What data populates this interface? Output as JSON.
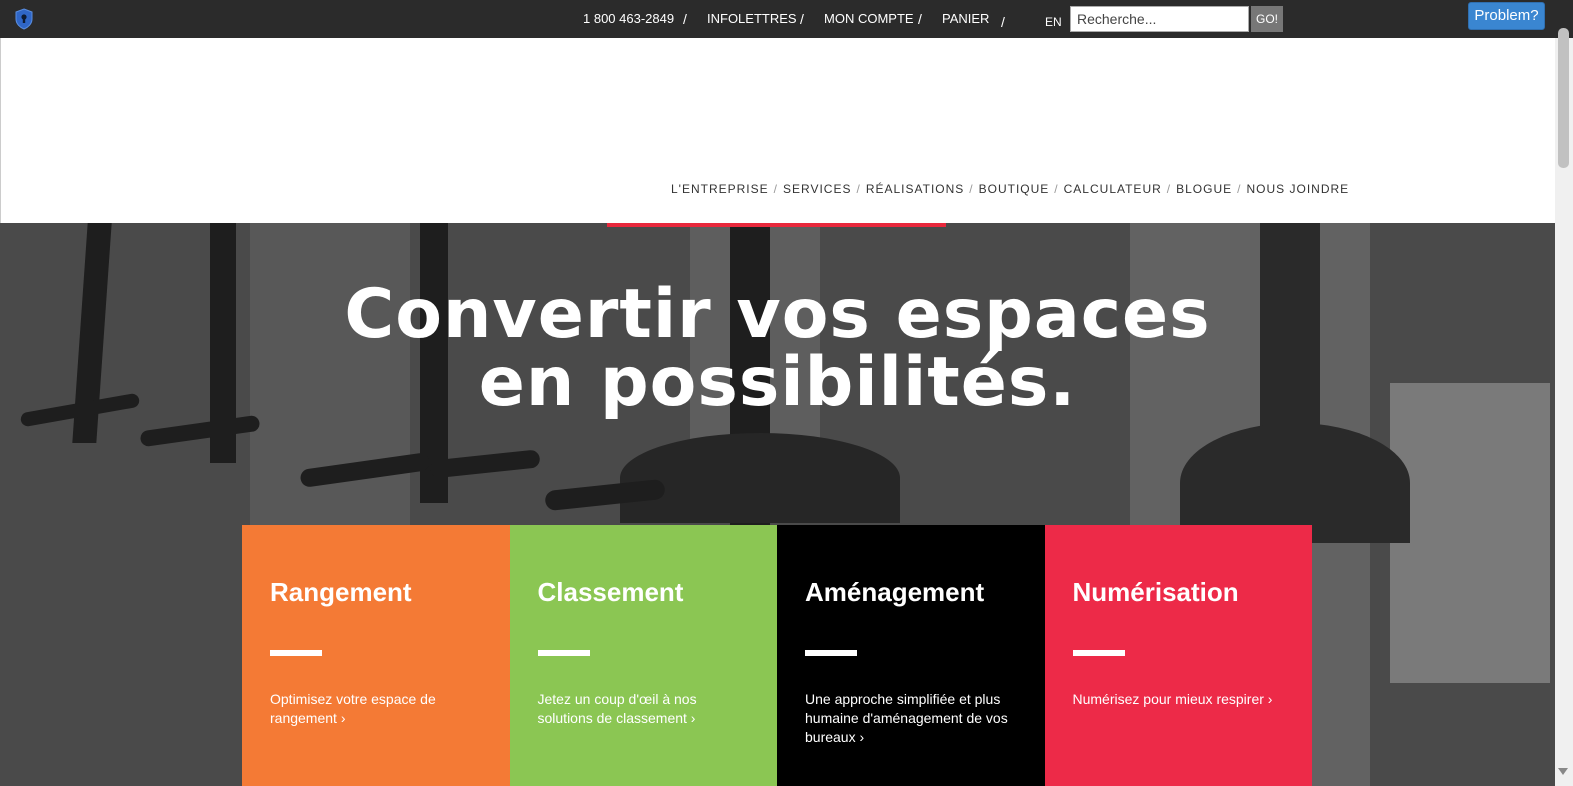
{
  "topbar": {
    "phone": "1 800 463-2849",
    "newsletters": "INFOLETTRES",
    "account": "MON COMPTE",
    "cart": "PANIER",
    "separator": "/",
    "lang": "EN",
    "search_placeholder": "Recherche...",
    "go_label": "GO!",
    "problem_label": "Problem?"
  },
  "nav": {
    "items": [
      "L'ENTREPRISE",
      "SERVICES",
      "RÉALISATIONS",
      "BOUTIQUE",
      "CALCULATEUR",
      "BLOGUE",
      "NOUS JOINDRE"
    ],
    "separator": "/"
  },
  "hero": {
    "line1": "Convertir vos espaces",
    "line2": "en possibilités."
  },
  "cards": [
    {
      "title": "Rangement",
      "text": "Optimisez votre espace de rangement ›",
      "color": "#f47a35"
    },
    {
      "title": "Classement",
      "text": "Jetez un coup d'œil à nos solutions de classement ›",
      "color": "#8bc653"
    },
    {
      "title": "Aménagement",
      "text": "Une approche simplifiée et plus humaine d'aménagement de vos bureaux ›",
      "color": "#000000"
    },
    {
      "title": "Numérisation",
      "text": "Numérisez pour mieux respirer ›",
      "color": "#ed2a48"
    }
  ],
  "colors": {
    "topbar": "#2b2b2b",
    "accent": "#e8283c",
    "problem_button": "#3a86d1"
  },
  "icons": {
    "shield": "shield-keyhole-icon"
  }
}
